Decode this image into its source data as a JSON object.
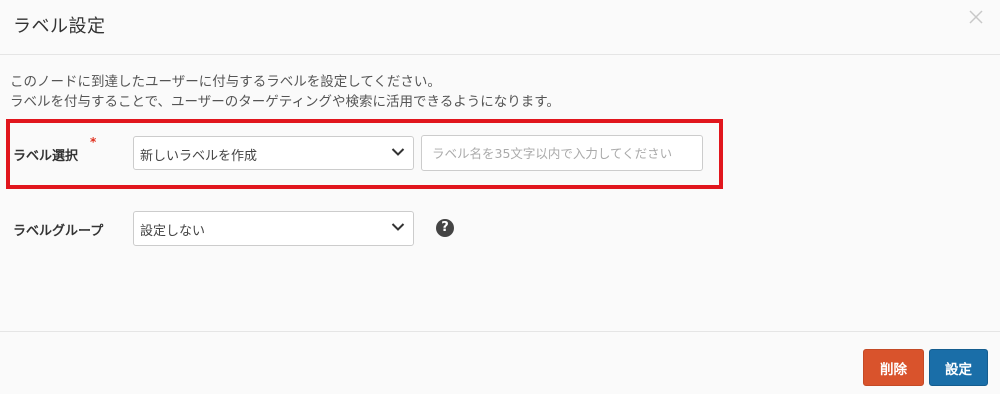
{
  "dialog": {
    "title": "ラベル設定",
    "close_icon": "close-icon"
  },
  "description": {
    "line1": "このノードに到達したユーザーに付与するラベルを設定してください。",
    "line2": "ラベルを付与することで、ユーザーのターゲティングや検索に活用できるようになります。"
  },
  "label_select": {
    "label": "ラベル選択",
    "required_mark": "*",
    "selected": "新しいラベルを作成",
    "name_placeholder": "ラベル名を35文字以内で入力してください"
  },
  "label_group": {
    "label": "ラベルグループ",
    "selected": "設定しない",
    "help_icon": "question-circle-icon",
    "help_glyph": "?"
  },
  "footer": {
    "delete_label": "削除",
    "save_label": "設定"
  },
  "colors": {
    "highlight": "#e1161d",
    "delete_button": "#d9532c",
    "save_button": "#1a6ea8",
    "required": "#e0301e"
  }
}
